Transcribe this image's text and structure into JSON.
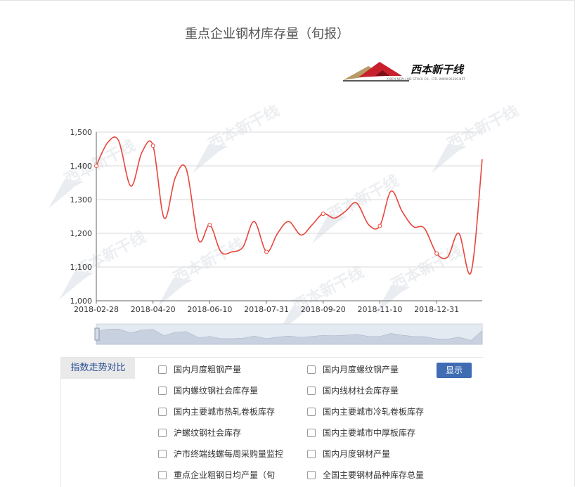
{
  "page": {
    "title": "重点企业钢材库存量（旬报）"
  },
  "logo": {
    "name": "西本新干线",
    "tagline": "XIBEN NEW LINE STOCK CO., LTD. WWW.96369.NET"
  },
  "watermark": {
    "text": "西本新干线"
  },
  "chart_data": {
    "type": "line",
    "title": "重点企业钢材库存量（旬报）",
    "xlabel": "",
    "ylabel": "",
    "ylim": [
      1000,
      1500
    ],
    "y_ticks": [
      "1,000",
      "1,100",
      "1,200",
      "1,300",
      "1,400",
      "1,500"
    ],
    "x_ticks": [
      "2018-02-28",
      "2018-04-20",
      "2018-06-10",
      "2018-07-31",
      "2018-09-20",
      "2018-11-10",
      "2018-12-31"
    ],
    "x_range": [
      "2018-02-28",
      "2019-02-10"
    ],
    "grid": true,
    "color": "#e8453c",
    "points": [
      {
        "x": "2018-02-28",
        "y": 1400
      },
      {
        "x": "2018-03-10",
        "y": 1468
      },
      {
        "x": "2018-03-20",
        "y": 1475
      },
      {
        "x": "2018-03-31",
        "y": 1340
      },
      {
        "x": "2018-04-10",
        "y": 1440
      },
      {
        "x": "2018-04-20",
        "y": 1460
      },
      {
        "x": "2018-04-30",
        "y": 1245
      },
      {
        "x": "2018-05-10",
        "y": 1365
      },
      {
        "x": "2018-05-20",
        "y": 1390
      },
      {
        "x": "2018-05-31",
        "y": 1180
      },
      {
        "x": "2018-06-10",
        "y": 1225
      },
      {
        "x": "2018-06-20",
        "y": 1145
      },
      {
        "x": "2018-06-30",
        "y": 1145
      },
      {
        "x": "2018-07-10",
        "y": 1160
      },
      {
        "x": "2018-07-20",
        "y": 1235
      },
      {
        "x": "2018-07-31",
        "y": 1145
      },
      {
        "x": "2018-08-10",
        "y": 1200
      },
      {
        "x": "2018-08-20",
        "y": 1235
      },
      {
        "x": "2018-08-31",
        "y": 1195
      },
      {
        "x": "2018-09-10",
        "y": 1225
      },
      {
        "x": "2018-09-20",
        "y": 1258
      },
      {
        "x": "2018-09-30",
        "y": 1245
      },
      {
        "x": "2018-10-10",
        "y": 1265
      },
      {
        "x": "2018-10-20",
        "y": 1290
      },
      {
        "x": "2018-10-31",
        "y": 1225
      },
      {
        "x": "2018-11-10",
        "y": 1222
      },
      {
        "x": "2018-11-20",
        "y": 1325
      },
      {
        "x": "2018-11-30",
        "y": 1265
      },
      {
        "x": "2018-12-10",
        "y": 1220
      },
      {
        "x": "2018-12-20",
        "y": 1215
      },
      {
        "x": "2018-12-31",
        "y": 1140
      },
      {
        "x": "2019-01-10",
        "y": 1130
      },
      {
        "x": "2019-01-20",
        "y": 1200
      },
      {
        "x": "2019-01-31",
        "y": 1085
      },
      {
        "x": "2019-02-10",
        "y": 1420
      }
    ],
    "markers": [
      "2018-02-28",
      "2018-04-20",
      "2018-06-10",
      "2018-07-31",
      "2018-09-20",
      "2018-11-10",
      "2018-12-31"
    ]
  },
  "panel": {
    "tab_label": "指数走势对比",
    "show_button": "显示",
    "options": [
      "国内月度粗钢产量",
      "国内月度螺纹钢产量",
      "国内螺纹钢社会库存量",
      "国内线材社会库存量",
      "国内主要城市热轧卷板库存",
      "国内主要城市冷轧卷板库存",
      "沪螺纹钢社会库存",
      "国内主要城市中厚板库存",
      "沪市终端线螺每周采购量监控",
      "国内月度钢材产量",
      "重点企业粗钢日均产量（旬",
      "全国主要钢材品种库存总量"
    ]
  }
}
